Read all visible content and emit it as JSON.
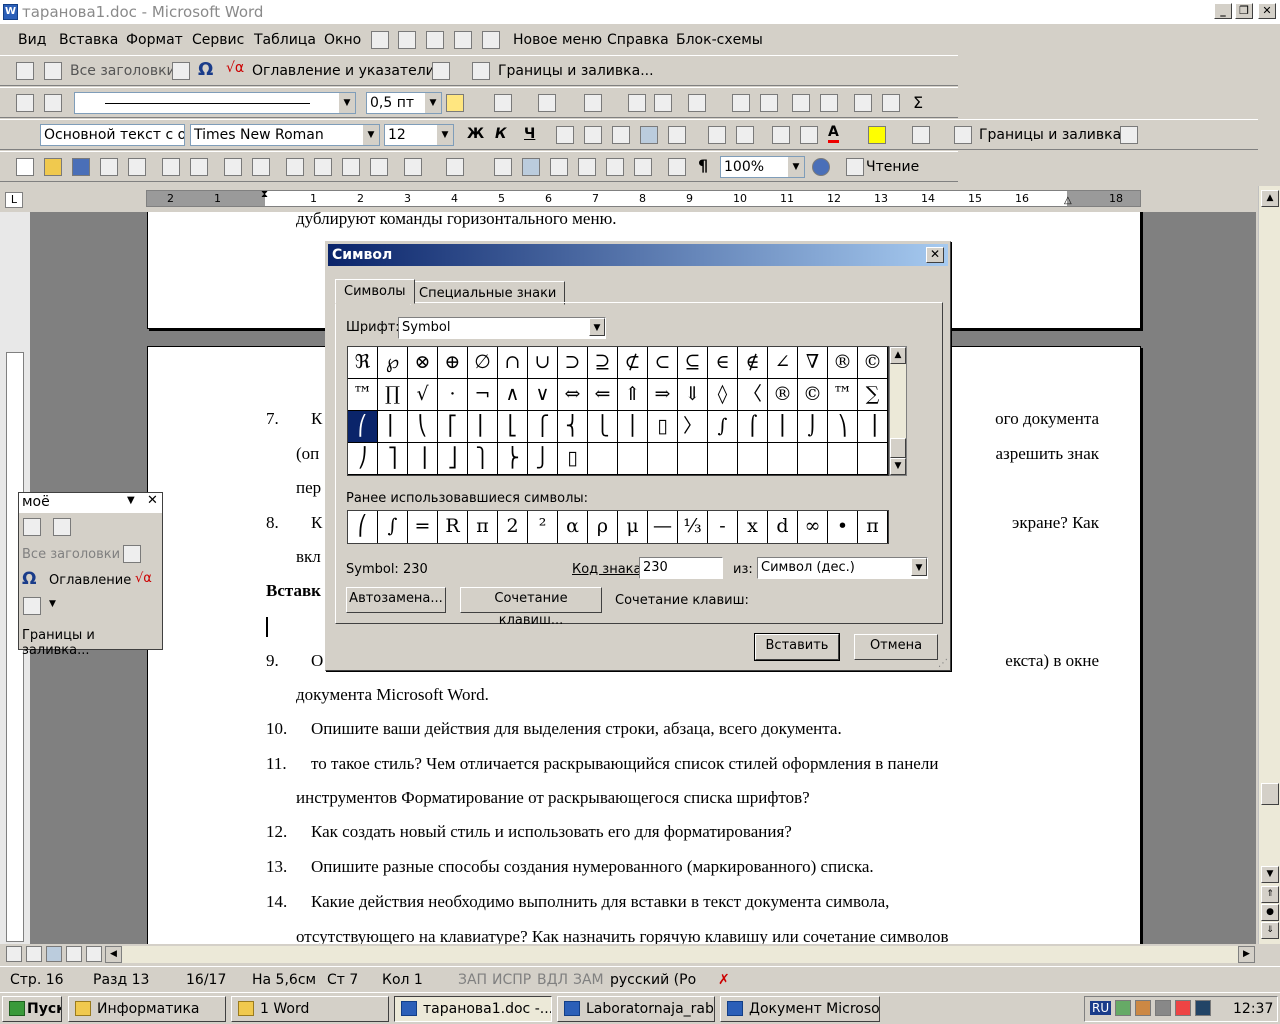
{
  "window": {
    "title": "таранова1.doc - Microsoft Word",
    "min": "_",
    "max": "❐",
    "close": "✕"
  },
  "menu": [
    "Вид",
    "Вставка",
    "Формат",
    "Сервис",
    "Таблица",
    "Окно",
    "Новое меню",
    "Справка",
    "Блок-схемы"
  ],
  "toolbar1": {
    "all_headings": "Все заголовки",
    "toc": "Оглавление и указатели...",
    "borders": "Границы и заливка..."
  },
  "toolbar2": {
    "line_width": "0,5 пт"
  },
  "toolbar3": {
    "style": "Основной текст с о",
    "font": "Times New Roman",
    "size": "12",
    "bold": "Ж",
    "italic": "К",
    "underline": "Ч",
    "borders": "Границы и заливка..."
  },
  "toolbar4": {
    "zoom": "100%",
    "pilcrow": "¶",
    "read": "Чтение"
  },
  "ruler": {
    "marks": [
      "2",
      "1",
      "1",
      "2",
      "3",
      "4",
      "5",
      "6",
      "7",
      "8",
      "9",
      "10",
      "11",
      "12",
      "13",
      "14",
      "15",
      "16",
      "18"
    ]
  },
  "document": {
    "top_line": "дублируют команды горизонтального меню.",
    "lines": [
      {
        "num": "7.",
        "text": "К",
        "right": "ого документа"
      },
      {
        "num": "",
        "text": "(оп",
        "right": "азрешить знак"
      },
      {
        "num": "",
        "text": "пер",
        "right": ""
      },
      {
        "num": "8.",
        "text": "К",
        "right": "экране?  Как"
      },
      {
        "num": "",
        "text": "вкл",
        "right": ""
      },
      {
        "num": "",
        "text": "Вставк",
        "right": ""
      },
      {
        "num": "9.",
        "text": "О",
        "right": "екста)  в  окне"
      },
      {
        "num": "",
        "text": "документа Microsoft Word.",
        "right": ""
      },
      {
        "num": "10.",
        "text": "Опишите ваши действия для выделения строки, абзаца, всего документа.",
        "right": ""
      },
      {
        "num": "11.",
        "text": "то такое стиль? Чем отличается раскрывающийся список стилей оформления в панели",
        "right": ""
      },
      {
        "num": "",
        "text": "инструментов Форматирование от раскрывающегося списка шрифтов?",
        "right": ""
      },
      {
        "num": "12.",
        "text": "Как создать новый стиль и использовать его для форматирования?",
        "right": ""
      },
      {
        "num": "13.",
        "text": "Опишите разные способы создания нумерованного (маркированного) списка.",
        "right": ""
      },
      {
        "num": "14.",
        "text": "Какие  действия  необходимо  выполнить  для  вставки  в  текст  документа  символа,",
        "right": ""
      },
      {
        "num": "",
        "text": "отсутствующего на клавиатуре? Как назначить горячую клавишу или сочетание символов",
        "right": ""
      }
    ]
  },
  "palette": {
    "title": "моё",
    "all_headings": "Все заголовки",
    "toc": "Оглавление",
    "borders": "Границы и заливка..."
  },
  "dialog": {
    "title": "Символ",
    "tabs": [
      "Символы",
      "Специальные знаки"
    ],
    "font_label": "Шрифт:",
    "font_value": "Symbol",
    "symbols": [
      [
        "ℜ",
        "℘",
        "⊗",
        "⊕",
        "∅",
        "∩",
        "∪",
        "⊃",
        "⊇",
        "⊄",
        "⊂",
        "⊆",
        "∈",
        "∉",
        "∠",
        "∇",
        "®",
        "©"
      ],
      [
        "™",
        "∏",
        "√",
        "⋅",
        "¬",
        "∧",
        "∨",
        "⇔",
        "⇐",
        "⇑",
        "⇒",
        "⇓",
        "◊",
        "〈",
        "®",
        "©",
        "™",
        "∑"
      ],
      [
        "⎛",
        "⎜",
        "⎝",
        "⎡",
        "⎢",
        "⎣",
        "⎧",
        "⎨",
        "⎩",
        "⎪",
        "▯",
        "〉",
        "∫",
        "⌠",
        "⎮",
        "⌡",
        "⎞",
        "⎟"
      ],
      [
        "⎠",
        "⎤",
        "⎥",
        "⎦",
        "⎫",
        "⎬",
        "⎭",
        "▯",
        "",
        "",
        "",
        "",
        "",
        "",
        "",
        "",
        "",
        ""
      ]
    ],
    "recent_label": "Ранее использовавшиеся символы:",
    "recent": [
      "⎛",
      "∫",
      "=",
      "R",
      "π",
      "2",
      "²",
      "α",
      "ρ",
      "μ",
      "—",
      "⅓",
      "-",
      "x",
      "d",
      "∞",
      "•",
      "π"
    ],
    "char_name": "Symbol: 230",
    "code_label": "Код знака:",
    "code_value": "230",
    "from_label": "из:",
    "from_value": "Символ (дес.)",
    "autocorrect": "Автозамена...",
    "shortcut_btn": "Сочетание клавиш...",
    "shortcut_label": "Сочетание клавиш:",
    "insert": "Вставить",
    "cancel": "Отмена"
  },
  "status": {
    "page": "Стр.  16",
    "section": "Разд  13",
    "pages": "16/17",
    "at": "На 5,6см",
    "line": "Ст  7",
    "col": "Кол  1",
    "rec": "ЗАП",
    "trk": "ИСПР",
    "ext": "ВДЛ",
    "ovr": "ЗАМ",
    "lang": "русский (Ро"
  },
  "taskbar": {
    "start": "Пуск",
    "items": [
      "Информатика",
      "1 Word",
      "таранова1.doc -...",
      "Laboratornaja_rab...",
      "Документ Microso..."
    ],
    "lang": "RU",
    "time": "12:37"
  }
}
